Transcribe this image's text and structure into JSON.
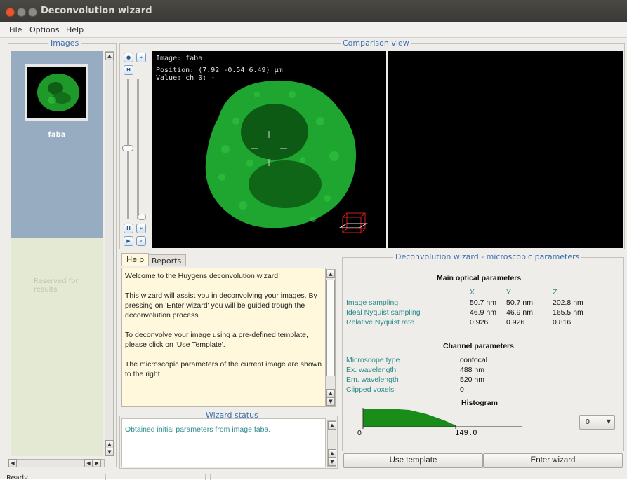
{
  "window": {
    "title": "Deconvolution wizard"
  },
  "menu": {
    "file": "File",
    "options": "Options",
    "help": "Help"
  },
  "images_panel": {
    "title": "Images",
    "items": [
      {
        "label": "faba"
      }
    ],
    "results_placeholder": "Reserved for results"
  },
  "comparison": {
    "title": "Comparison view",
    "overlay": {
      "image": "Image: faba",
      "position": "Position: (7.92 -0.54 6.49) µm",
      "value": "Value: ch 0: -"
    }
  },
  "tabs": [
    {
      "label": "Help"
    },
    {
      "label": "Reports"
    }
  ],
  "help_text": {
    "p1": "Welcome to the Huygens deconvolution wizard!",
    "p2": "This wizard will assist you in deconvolving your images. By pressing on 'Enter wizard' you will be guided trough the deconvolution process.",
    "p3": "To deconvolve your image using a pre-defined template, please click on 'Use Template'.",
    "p4": "The microscopic parameters of the current image are shown to the right."
  },
  "wizard_status": {
    "title": "Wizard status",
    "message": "Obtained initial parameters from image faba."
  },
  "params": {
    "title": "Deconvolution wizard - microscopic parameters",
    "main_title": "Main optical parameters",
    "columns": [
      "X",
      "Y",
      "Z"
    ],
    "rows": [
      {
        "label": "Image sampling",
        "x": "50.7 nm",
        "y": "50.7 nm",
        "z": "202.8 nm"
      },
      {
        "label": "Ideal Nyquist sampling",
        "x": "46.9 nm",
        "y": "46.9 nm",
        "z": "165.5 nm"
      },
      {
        "label": "Relative Nyquist rate",
        "x": "0.926",
        "y": "0.926",
        "z": "0.816"
      }
    ],
    "channel_title": "Channel parameters",
    "channel_rows": [
      {
        "label": "Microscope type",
        "value": "confocal"
      },
      {
        "label": "Ex. wavelength",
        "value": "488 nm"
      },
      {
        "label": "Em. wavelength",
        "value": "520 nm"
      },
      {
        "label": "Clipped voxels",
        "value": "0"
      }
    ],
    "histogram_title": "Histogram",
    "hist_min": "0",
    "hist_max": "149.0",
    "channel_select": "0"
  },
  "buttons": {
    "use_template": "Use template",
    "enter_wizard": "Enter wizard"
  },
  "statusbar": {
    "text": "Ready"
  },
  "colors": {
    "accent_title": "#3a6fb0",
    "param_label": "#2d8a8a",
    "histogram": "#1a8c1a",
    "help_bg": "#fff8dc"
  }
}
